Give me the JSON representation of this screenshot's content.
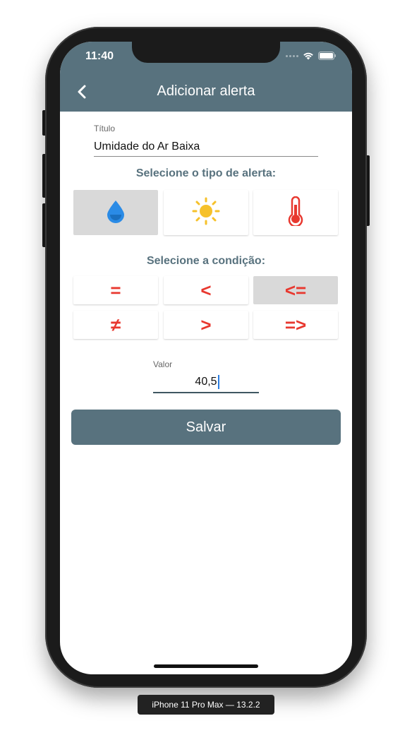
{
  "status_bar": {
    "time": "11:40"
  },
  "header": {
    "title": "Adicionar alerta",
    "back_icon": "chevron-left-icon"
  },
  "form": {
    "title_label": "Título",
    "title_value": "Umidade do Ar Baixa",
    "type_heading": "Selecione o tipo de alerta:",
    "alert_types": [
      {
        "name": "humidity",
        "icon": "water-drop-icon",
        "selected": true
      },
      {
        "name": "sun",
        "icon": "sun-icon",
        "selected": false
      },
      {
        "name": "temperature",
        "icon": "thermometer-icon",
        "selected": false
      }
    ],
    "condition_heading": "Selecione a condição:",
    "conditions": [
      {
        "symbol": "=",
        "name": "equal",
        "selected": false
      },
      {
        "symbol": "<",
        "name": "less-than",
        "selected": false
      },
      {
        "symbol": "<=",
        "name": "less-or-equal",
        "selected": true
      },
      {
        "symbol": "≠",
        "name": "not-equal",
        "selected": false
      },
      {
        "symbol": ">",
        "name": "greater-than",
        "selected": false
      },
      {
        "symbol": "=>",
        "name": "greater-or-equal",
        "selected": false
      }
    ],
    "value_label": "Valor",
    "value": "40,5",
    "save_label": "Salvar"
  },
  "colors": {
    "header": "#58727e",
    "accent_red": "#e8382f",
    "drop_blue": "#2a8be6",
    "sun_yellow": "#f6c12a",
    "selected_tile": "#d9d9d9"
  },
  "device_caption": "iPhone 11 Pro Max — 13.2.2"
}
